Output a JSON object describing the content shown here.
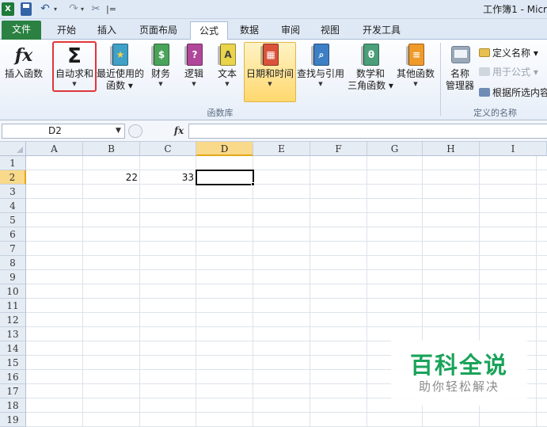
{
  "window": {
    "title": "工作簿1 - Micr"
  },
  "quick_access": {
    "app_icon": "X",
    "undo_glyph": "↶",
    "redo_glyph": "↷",
    "wand_glyph": "✂",
    "more_glyph": "|="
  },
  "tabs": [
    {
      "label": "文件"
    },
    {
      "label": "开始"
    },
    {
      "label": "插入"
    },
    {
      "label": "页面布局"
    },
    {
      "label": "公式"
    },
    {
      "label": "数据"
    },
    {
      "label": "审阅"
    },
    {
      "label": "视图"
    },
    {
      "label": "开发工具"
    }
  ],
  "ribbon": {
    "insert_function": {
      "glyph": "fx",
      "label": "插入函数"
    },
    "autosum": {
      "glyph": "Σ",
      "label": "自动求和"
    },
    "recent": {
      "label1": "最近使用的",
      "label2": "函数 ▾"
    },
    "financial": {
      "label": "财务"
    },
    "logical": {
      "label": "逻辑",
      "glyph": "?"
    },
    "text": {
      "label": "文本",
      "glyph": "A"
    },
    "datetime": {
      "label": "日期和时间"
    },
    "lookup": {
      "label": "查找与引用"
    },
    "math": {
      "label1": "数学和",
      "label2": "三角函数 ▾",
      "glyph": "θ"
    },
    "more": {
      "label": "其他函数"
    },
    "group_function_library": "函数库",
    "name_manager": {
      "label1": "名称",
      "label2": "管理器"
    },
    "define_name": "定义名称 ▾",
    "use_in_formula": "用于公式 ▾",
    "create_from_selection": "根据所选内容",
    "group_defined_names": "定义的名称"
  },
  "formula_bar": {
    "name_box": "D2",
    "fx": "fx",
    "formula": ""
  },
  "columns": [
    "A",
    "B",
    "C",
    "D",
    "E",
    "F",
    "G",
    "H",
    "I"
  ],
  "rows": [
    "1",
    "2",
    "3",
    "4",
    "5",
    "6",
    "7",
    "8",
    "9",
    "10",
    "11",
    "12",
    "13",
    "14",
    "15",
    "16",
    "17",
    "18",
    "19"
  ],
  "active_cell": "D2",
  "cells": {
    "B2": "22",
    "C2": "33"
  },
  "watermark": {
    "title": "百科全说",
    "subtitle": "助你轻松解决"
  }
}
